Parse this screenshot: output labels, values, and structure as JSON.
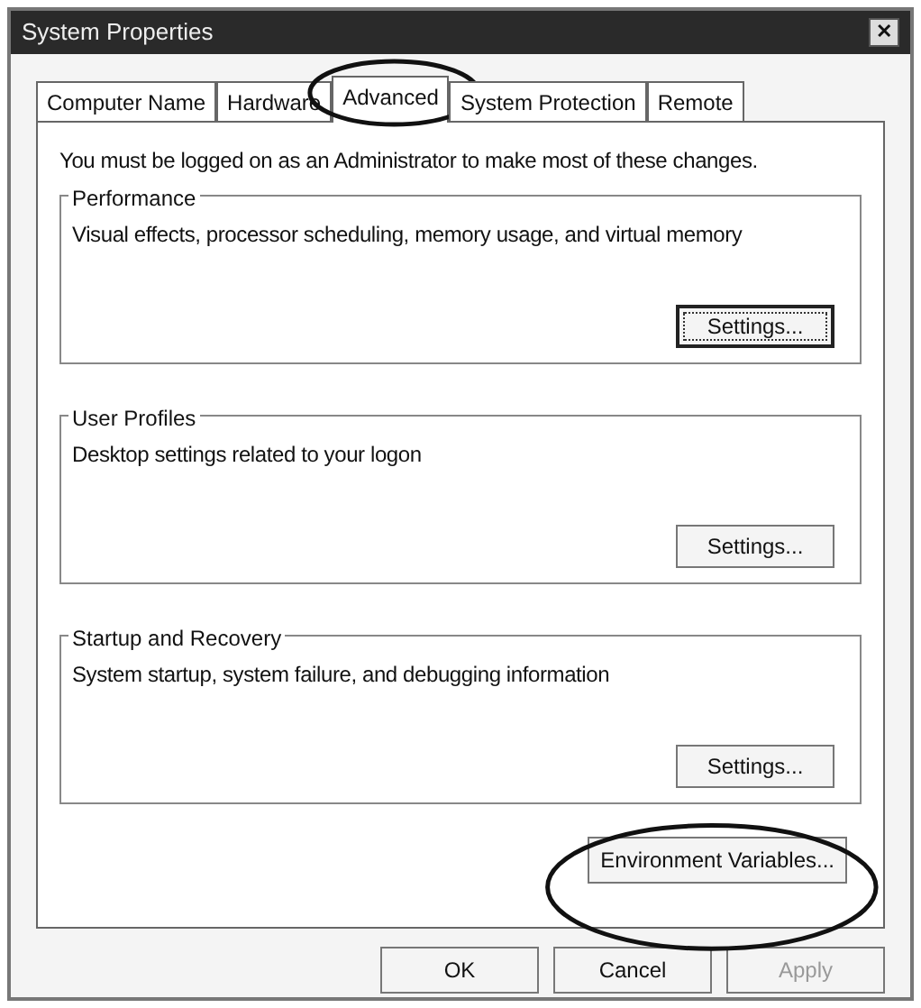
{
  "window": {
    "title": "System Properties",
    "close": "✕"
  },
  "tabs": [
    {
      "label": "Computer Name",
      "selected": false,
      "circled": false
    },
    {
      "label": "Hardware",
      "selected": false,
      "circled": false
    },
    {
      "label": "Advanced",
      "selected": true,
      "circled": true
    },
    {
      "label": "System Protection",
      "selected": false,
      "circled": false
    },
    {
      "label": "Remote",
      "selected": false,
      "circled": false
    }
  ],
  "notice": "You must be logged on as an Administrator to make most of these changes.",
  "groups": [
    {
      "title": "Performance",
      "description": "Visual effects, processor scheduling, memory usage, and virtual memory",
      "button": "Settings...",
      "focused": true
    },
    {
      "title": "User Profiles",
      "description": "Desktop settings related to your logon",
      "button": "Settings...",
      "focused": false
    },
    {
      "title": "Startup and Recovery",
      "description": "System startup, system failure, and debugging information",
      "button": "Settings...",
      "focused": false
    }
  ],
  "environment_button": {
    "label": "Environment Variables...",
    "circled": true
  },
  "buttons": [
    {
      "label": "OK",
      "disabled": false
    },
    {
      "label": "Cancel",
      "disabled": false
    },
    {
      "label": "Apply",
      "disabled": true
    }
  ]
}
